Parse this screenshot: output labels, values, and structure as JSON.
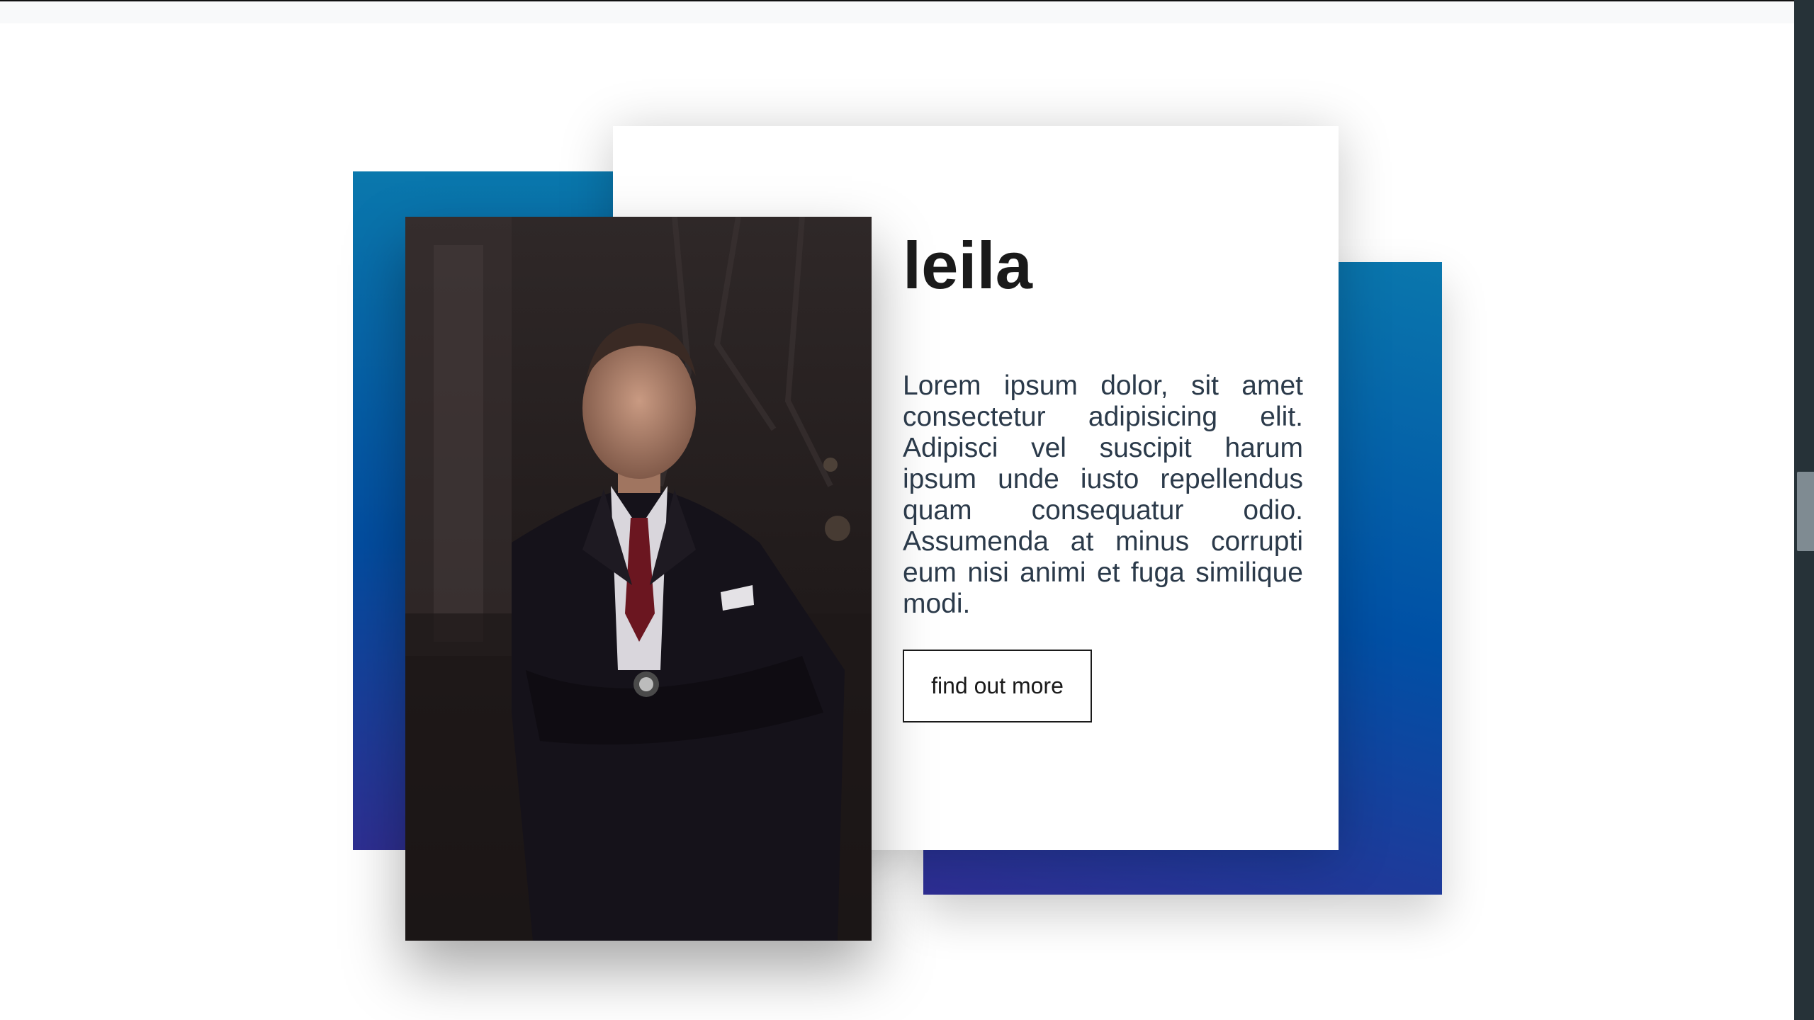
{
  "card": {
    "title": "leila",
    "description": "Lorem ipsum dolor, sit amet consectetur adipisicing elit. Adipisci vel suscipit harum ipsum unde iusto repellendus quam consequatur odio. Assumenda at minus corrupti eum nisi animi et fuga similique modi.",
    "button_label": "find out more"
  },
  "icons": {
    "photo": "person-in-suit-photo"
  },
  "colors": {
    "accent_blue_top": "#0a78ad",
    "accent_blue_mid": "#0050a5",
    "accent_indigo": "#2e2f92",
    "text_dark": "#1a1a1a",
    "text_body": "#2b3a4a",
    "scrollbar": "#263238"
  }
}
